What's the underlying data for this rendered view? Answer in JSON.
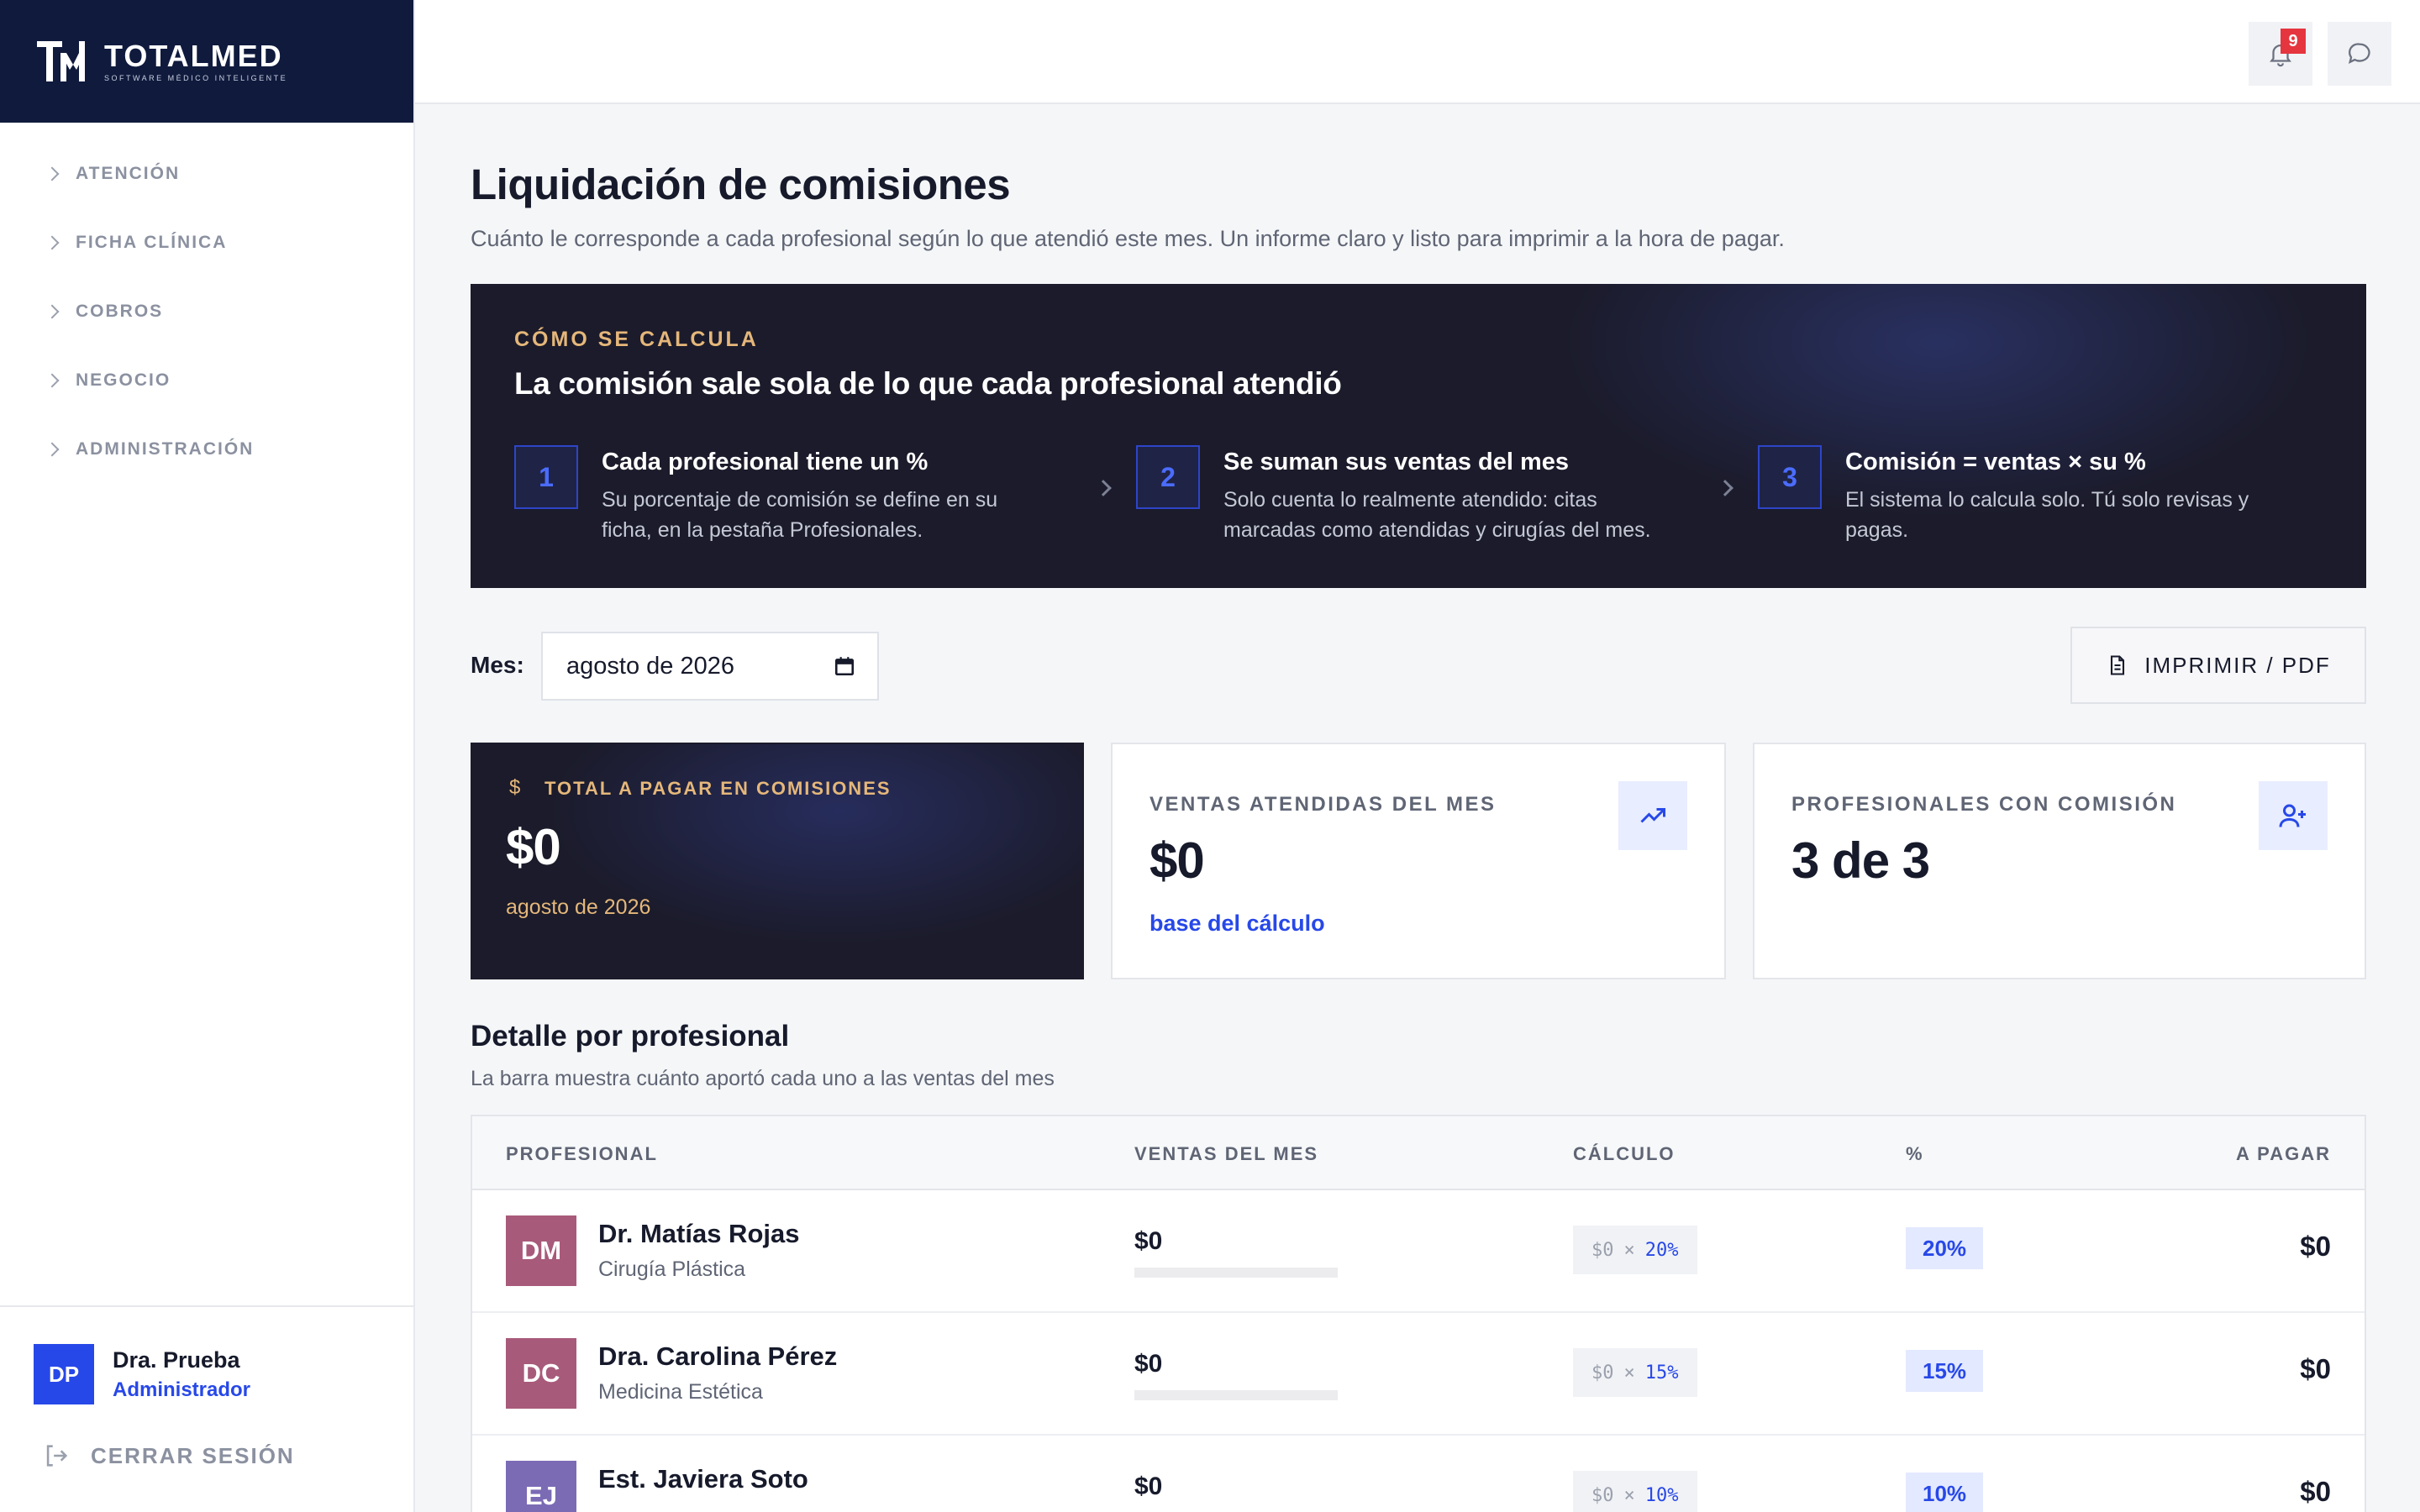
{
  "brand": {
    "name": "TOTALMED",
    "tagline": "SOFTWARE MÉDICO INTELIGENTE"
  },
  "sidebar": {
    "items": [
      {
        "label": "ATENCIÓN"
      },
      {
        "label": "FICHA CLÍNICA"
      },
      {
        "label": "COBROS"
      },
      {
        "label": "NEGOCIO"
      },
      {
        "label": "ADMINISTRACIÓN"
      }
    ],
    "user": {
      "initials": "DP",
      "name": "Dra. Prueba",
      "role": "Administrador"
    },
    "logout_label": "CERRAR SESIÓN"
  },
  "topbar": {
    "notifications_count": "9"
  },
  "page": {
    "title": "Liquidación de comisiones",
    "subtitle": "Cuánto le corresponde a cada profesional según lo que atendió este mes. Un informe claro y listo para imprimir a la hora de pagar."
  },
  "how": {
    "eyebrow": "CÓMO SE CALCULA",
    "title": "La comisión sale sola de lo que cada profesional atendió",
    "steps": [
      {
        "num": "1",
        "title": "Cada profesional tiene un %",
        "desc": "Su porcentaje de comisión se define en su ficha, en la pestaña Profesionales."
      },
      {
        "num": "2",
        "title": "Se suman sus ventas del mes",
        "desc": "Solo cuenta lo realmente atendido: citas marcadas como atendidas y cirugías del mes."
      },
      {
        "num": "3",
        "title": "Comisión = ventas × su %",
        "desc": "El sistema lo calcula solo. Tú solo revisas y pagas."
      }
    ]
  },
  "filter": {
    "label": "Mes:",
    "value": "agosto de 2026",
    "print_label": "IMPRIMIR / PDF"
  },
  "cards": {
    "total": {
      "label": "TOTAL A PAGAR EN COMISIONES",
      "value": "$0",
      "foot": "agosto de 2026"
    },
    "sales": {
      "label": "VENTAS ATENDIDAS DEL MES",
      "value": "$0",
      "foot": "base del cálculo"
    },
    "pros": {
      "label": "PROFESIONALES CON COMISIÓN",
      "value": "3 de 3"
    }
  },
  "detail": {
    "title": "Detalle por profesional",
    "subtitle": "La barra muestra cuánto aportó cada uno a las ventas del mes",
    "columns": [
      "PROFESIONAL",
      "VENTAS DEL MES",
      "CÁLCULO",
      "%",
      "A PAGAR"
    ],
    "rows": [
      {
        "initials": "DM",
        "avatar_color": "#a85a7a",
        "name": "Dr. Matías Rojas",
        "specialty": "Cirugía Plástica",
        "sales": "$0",
        "share": 0,
        "calc_base": "$0",
        "calc_x": "×",
        "calc_pct": "20%",
        "pct": "20%",
        "pay": "$0"
      },
      {
        "initials": "DC",
        "avatar_color": "#a85a7a",
        "name": "Dra. Carolina Pérez",
        "specialty": "Medicina Estética",
        "sales": "$0",
        "share": 0,
        "calc_base": "$0",
        "calc_x": "×",
        "calc_pct": "15%",
        "pct": "15%",
        "pay": "$0"
      },
      {
        "initials": "EJ",
        "avatar_color": "#7b6bb5",
        "name": "Est. Javiera Soto",
        "specialty": "",
        "sales": "$0",
        "share": 0,
        "calc_base": "$0",
        "calc_x": "×",
        "calc_pct": "10%",
        "pct": "10%",
        "pay": "$0"
      }
    ]
  },
  "colors": {
    "navy": "#0f1a3d",
    "accent": "#2748e8",
    "gold": "#e5b77a",
    "dark_panel": "#1b1b2b",
    "badge_red": "#e5353f"
  }
}
